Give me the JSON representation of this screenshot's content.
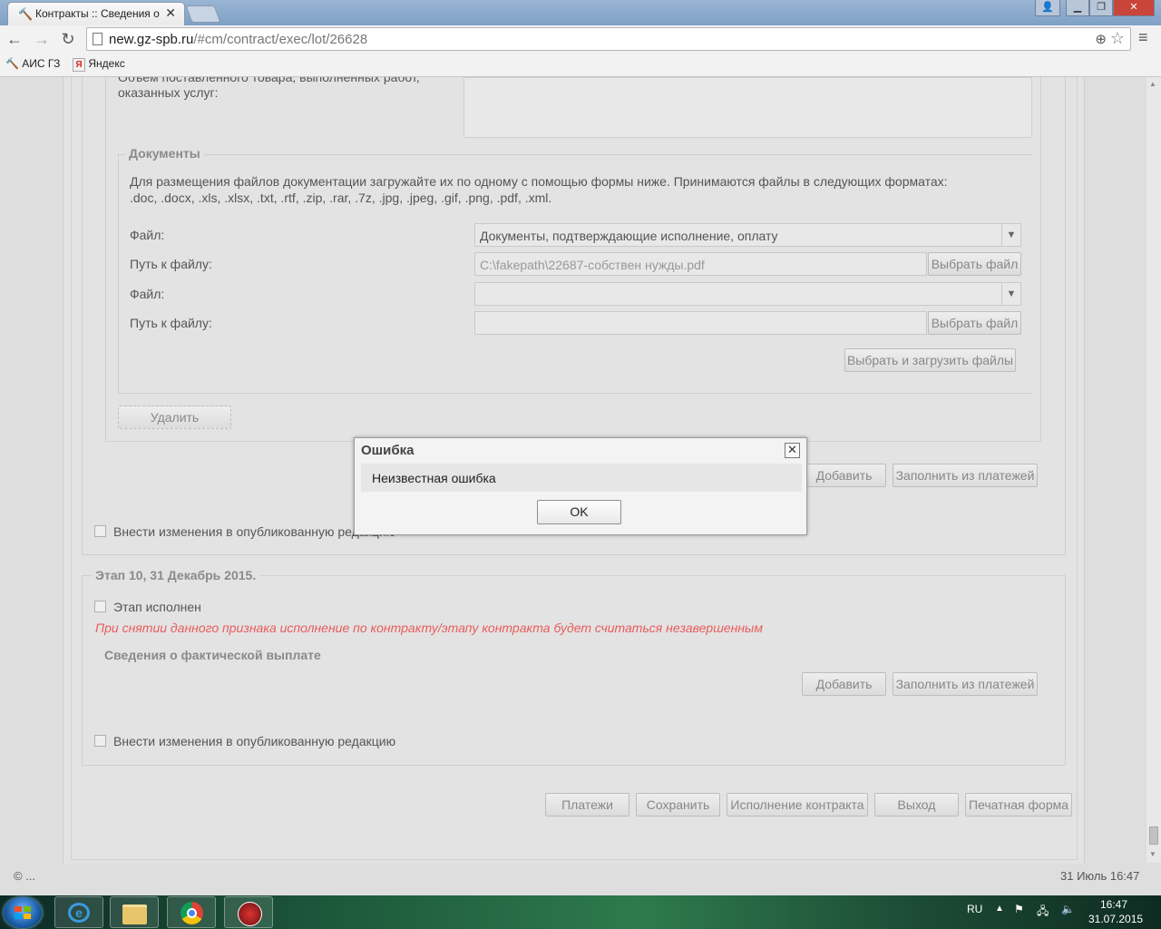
{
  "browser": {
    "tab_title": "Контракты :: Сведения о",
    "url_host": "new.gz-spb.ru",
    "url_path": "/#cm/contract/exec/lot/26628",
    "bookmarks": [
      "АИС ГЗ",
      "Яндекс"
    ]
  },
  "form": {
    "volume_label_line1": "Объем поставленного товара, выполненных работ,",
    "volume_label_line2": "оказанных услуг:",
    "documents_legend": "Документы",
    "documents_info_line1": "Для размещения файлов документации загружайте их по одному с помощью формы ниже. Принимаются файлы в следующих форматах:",
    "documents_info_line2": ".doc, .docx, .xls, .xlsx, .txt, .rtf, .zip, .rar, .7z, .jpg, .jpeg, .gif, .png, .pdf, .xml.",
    "file_label": "Файл:",
    "path_label": "Путь к файлу:",
    "file1_value": "Документы, подтверждающие исполнение, оплату",
    "path1_value": "C:\\fakepath\\22687-собствен нужды.pdf",
    "file2_value": "",
    "path2_value": "",
    "choose_file": "Выбрать файл",
    "choose_upload": "Выбрать и загрузить файлы",
    "delete": "Удалить",
    "add": "Добавить",
    "fill_from_payments": "Заполнить из платежей",
    "publish_changes": "Внести изменения в опубликованную редакцию",
    "stage10_legend": "Этап 10, 31 Декабрь 2015.",
    "stage_done": "Этап исполнен",
    "stage_warning": "При снятии данного признака исполнение по контракту/этапу контракта будет считаться незавершенным",
    "payment_info": "Сведения о фактической выплате"
  },
  "bottom_buttons": [
    "Платежи",
    "Сохранить",
    "Исполнение контракта",
    "Выход",
    "Печатная форма"
  ],
  "status": {
    "copyright": "© ...",
    "datetime": "31 Июль 16:47"
  },
  "dialog": {
    "title": "Ошибка",
    "message": "Неизвестная ошибка",
    "ok": "OK"
  },
  "taskbar": {
    "lang": "RU",
    "time": "16:47",
    "date": "31.07.2015"
  }
}
